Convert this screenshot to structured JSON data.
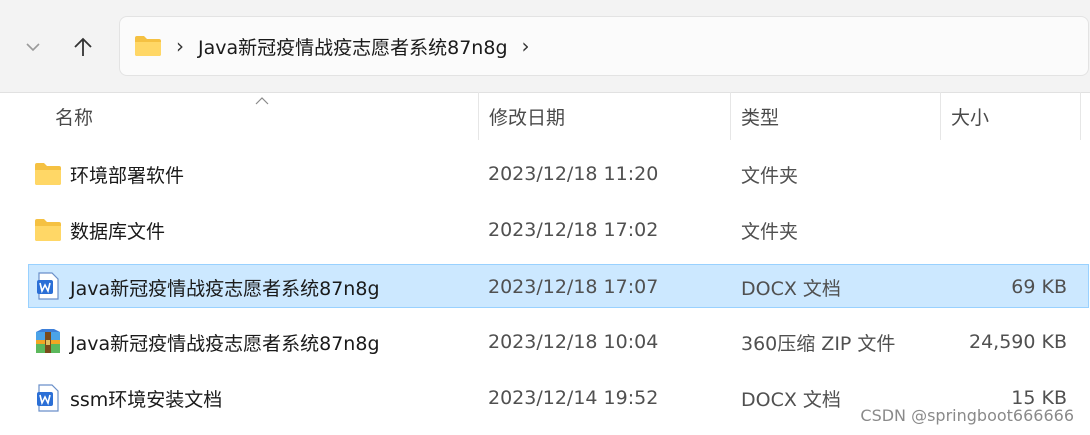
{
  "address_bar": {
    "path": "Java新冠疫情战疫志愿者系统87n8g"
  },
  "columns": {
    "name": "名称",
    "modified": "修改日期",
    "type": "类型",
    "size": "大小"
  },
  "files": [
    {
      "name": "环境部署软件",
      "modified": "2023/12/18 11:20",
      "type": "文件夹",
      "size": "",
      "icon": "folder-icon"
    },
    {
      "name": "数据库文件",
      "modified": "2023/12/18 17:02",
      "type": "文件夹",
      "size": "",
      "icon": "folder-icon"
    },
    {
      "name": "Java新冠疫情战疫志愿者系统87n8g",
      "modified": "2023/12/18 17:07",
      "type": "DOCX 文档",
      "size": "69 KB",
      "icon": "docx-icon",
      "selected": true
    },
    {
      "name": "Java新冠疫情战疫志愿者系统87n8g",
      "modified": "2023/12/18 10:04",
      "type": "360压缩 ZIP 文件",
      "size": "24,590 KB",
      "icon": "zip-archive-icon"
    },
    {
      "name": "ssm环境安装文档",
      "modified": "2023/12/14 19:52",
      "type": "DOCX 文档",
      "size": "15 KB",
      "icon": "docx-icon"
    }
  ],
  "watermark": "CSDN @springboot666666",
  "colors": {
    "selection": "#cce8ff",
    "selection_border": "#99d1ff",
    "folder": "#f5c142",
    "docx": "#2b6fd6"
  }
}
